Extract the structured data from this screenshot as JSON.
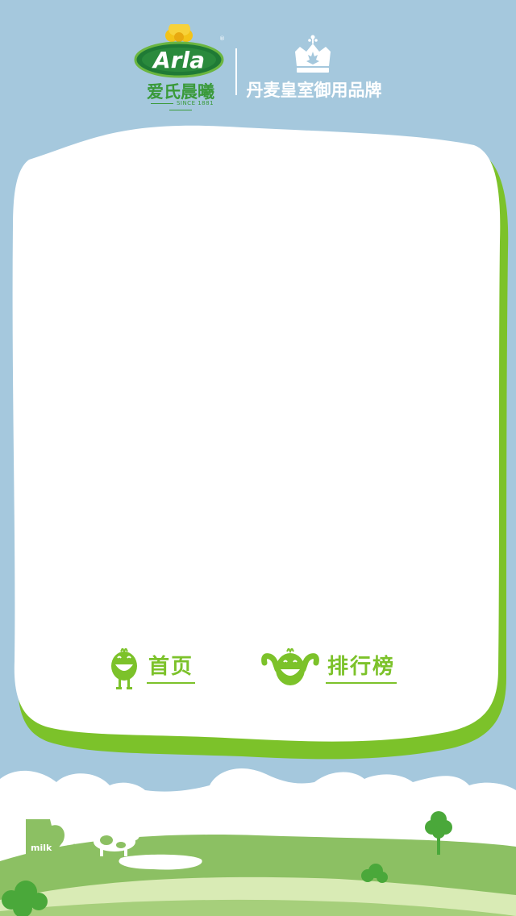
{
  "header": {
    "logo_wordmark": "Arla",
    "brand_name": "爱氏晨曦",
    "since": "SINCE 1881",
    "royal_brand": "丹麦皇室御用品牌"
  },
  "nav": {
    "home_label": "首页",
    "ranking_label": "排行榜"
  },
  "landscape": {
    "jug_label": "milk"
  },
  "colors": {
    "sky": "#a5c8dd",
    "accent_green": "#7cc22a",
    "brand_green": "#3a9a3a",
    "card": "#ffffff"
  },
  "icons": [
    "arla-logo-icon",
    "crown-icon",
    "smiling-mascot-icon",
    "flexing-mascot-icon",
    "milk-jug-icon",
    "cow-icon",
    "tree-icon"
  ]
}
